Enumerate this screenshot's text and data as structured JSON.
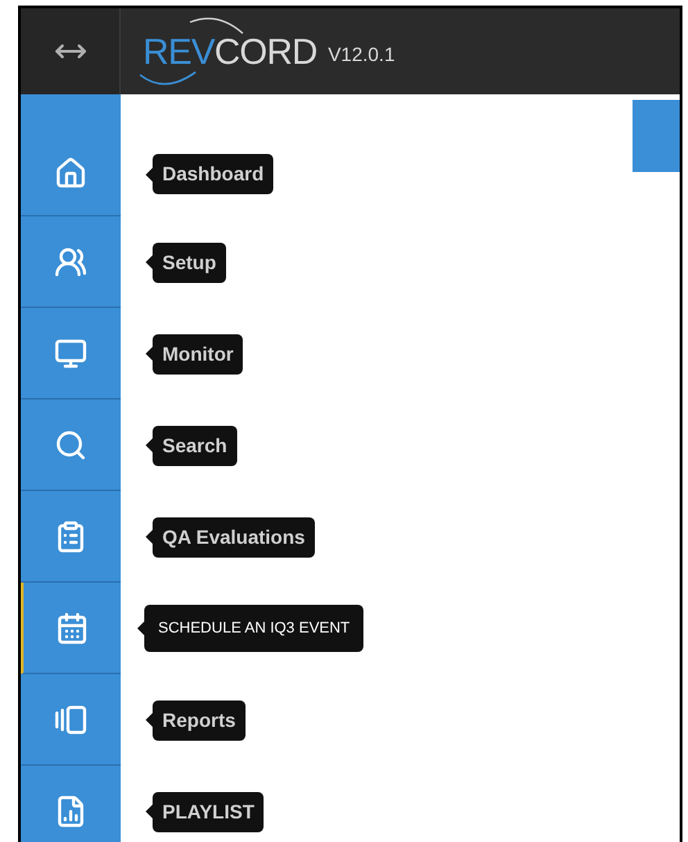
{
  "header": {
    "logo_part_1": "REV",
    "logo_part_2": "CORD",
    "version": "V12.0.1"
  },
  "sidebar": {
    "items": [
      {
        "label": "Dashboard",
        "selected": false
      },
      {
        "label": "Setup",
        "selected": false
      },
      {
        "label": "Monitor",
        "selected": false
      },
      {
        "label": "Search",
        "selected": false
      },
      {
        "label": "QA Evaluations",
        "selected": false
      },
      {
        "label": "SCHEDULE AN IQ3 EVENT",
        "selected": true
      },
      {
        "label": "Reports",
        "selected": false
      },
      {
        "label": "PLAYLIST",
        "selected": false
      }
    ]
  }
}
